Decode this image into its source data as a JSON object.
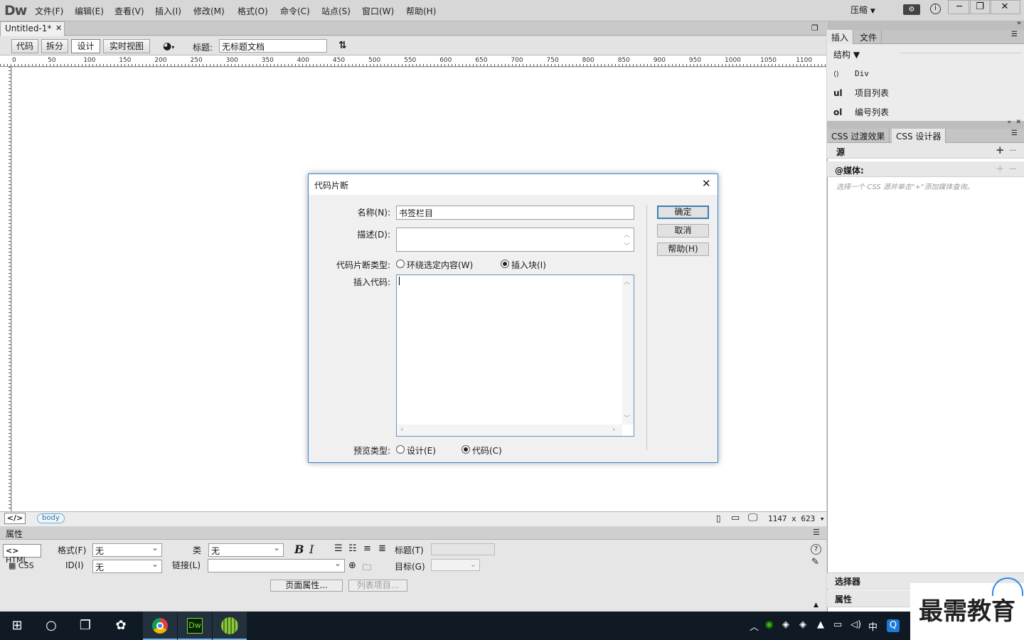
{
  "app": {
    "logo": "Dw",
    "menu": [
      "文件(F)",
      "编辑(E)",
      "查看(V)",
      "插入(I)",
      "修改(M)",
      "格式(O)",
      "命令(C)",
      "站点(S)",
      "窗口(W)",
      "帮助(H)"
    ],
    "compress_label": "压缩",
    "window_controls": [
      "minimize-icon",
      "restore-icon",
      "close-icon"
    ]
  },
  "document": {
    "tab_label": "Untitled-1*",
    "views": [
      "代码",
      "拆分",
      "设计",
      "实时视图"
    ],
    "active_view": "设计",
    "title_label": "标题:",
    "title_value": "无标题文档"
  },
  "ruler": {
    "ticks": [
      "0",
      "50",
      "100",
      "150",
      "200",
      "250",
      "300",
      "350",
      "400",
      "450",
      "500",
      "550",
      "600",
      "650",
      "700",
      "750",
      "800",
      "850",
      "900",
      "950",
      "1000",
      "1050",
      "1100"
    ]
  },
  "tagbar": {
    "code_icon": "</>",
    "body_tag": "body",
    "size": "1147 x 623"
  },
  "properties": {
    "header": "属性",
    "html_btn": "HTML",
    "css_btn": "CSS",
    "format_label": "格式(F)",
    "format_value": "无",
    "class_label": "类",
    "class_value": "无",
    "id_label": "ID(I)",
    "id_value": "无",
    "link_label": "链接(L)",
    "link_value": "",
    "title_label": "标题(T)",
    "target_label": "目标(G)",
    "page_props_btn": "页面属性...",
    "list_item_btn": "列表项目..."
  },
  "right_panel": {
    "tabs_top": [
      "插入",
      "文件"
    ],
    "category": "结构",
    "insert_items": [
      {
        "code": "<>",
        "label": "Div"
      },
      {
        "code": "ul",
        "label": "项目列表"
      },
      {
        "code": "ol",
        "label": "编号列表"
      }
    ],
    "tabs_css": [
      "CSS 过渡效果",
      "CSS 设计器"
    ],
    "source_label": "源",
    "media_label": "@媒体:",
    "media_hint": "选择一个 CSS 源并单击\"+\"添加媒体查询。",
    "selector_label": "选择器",
    "properties_label": "属性"
  },
  "dialog": {
    "title": "代码片断",
    "name_label": "名称(N):",
    "name_value": "书签栏目",
    "desc_label": "描述(D):",
    "desc_value": "",
    "type_label": "代码片断类型:",
    "type_wrap": "环绕选定内容(W)",
    "type_block": "插入块(I)",
    "type_selected": "插入块(I)",
    "insert_label": "插入代码:",
    "insert_value": "",
    "preview_label": "预览类型:",
    "preview_design": "设计(E)",
    "preview_code": "代码(C)",
    "preview_selected": "代码(C)",
    "ok": "确定",
    "cancel": "取消",
    "help": "帮助(H)"
  },
  "taskbar": {
    "tray_lang": "中",
    "watermark": "最需教育"
  }
}
